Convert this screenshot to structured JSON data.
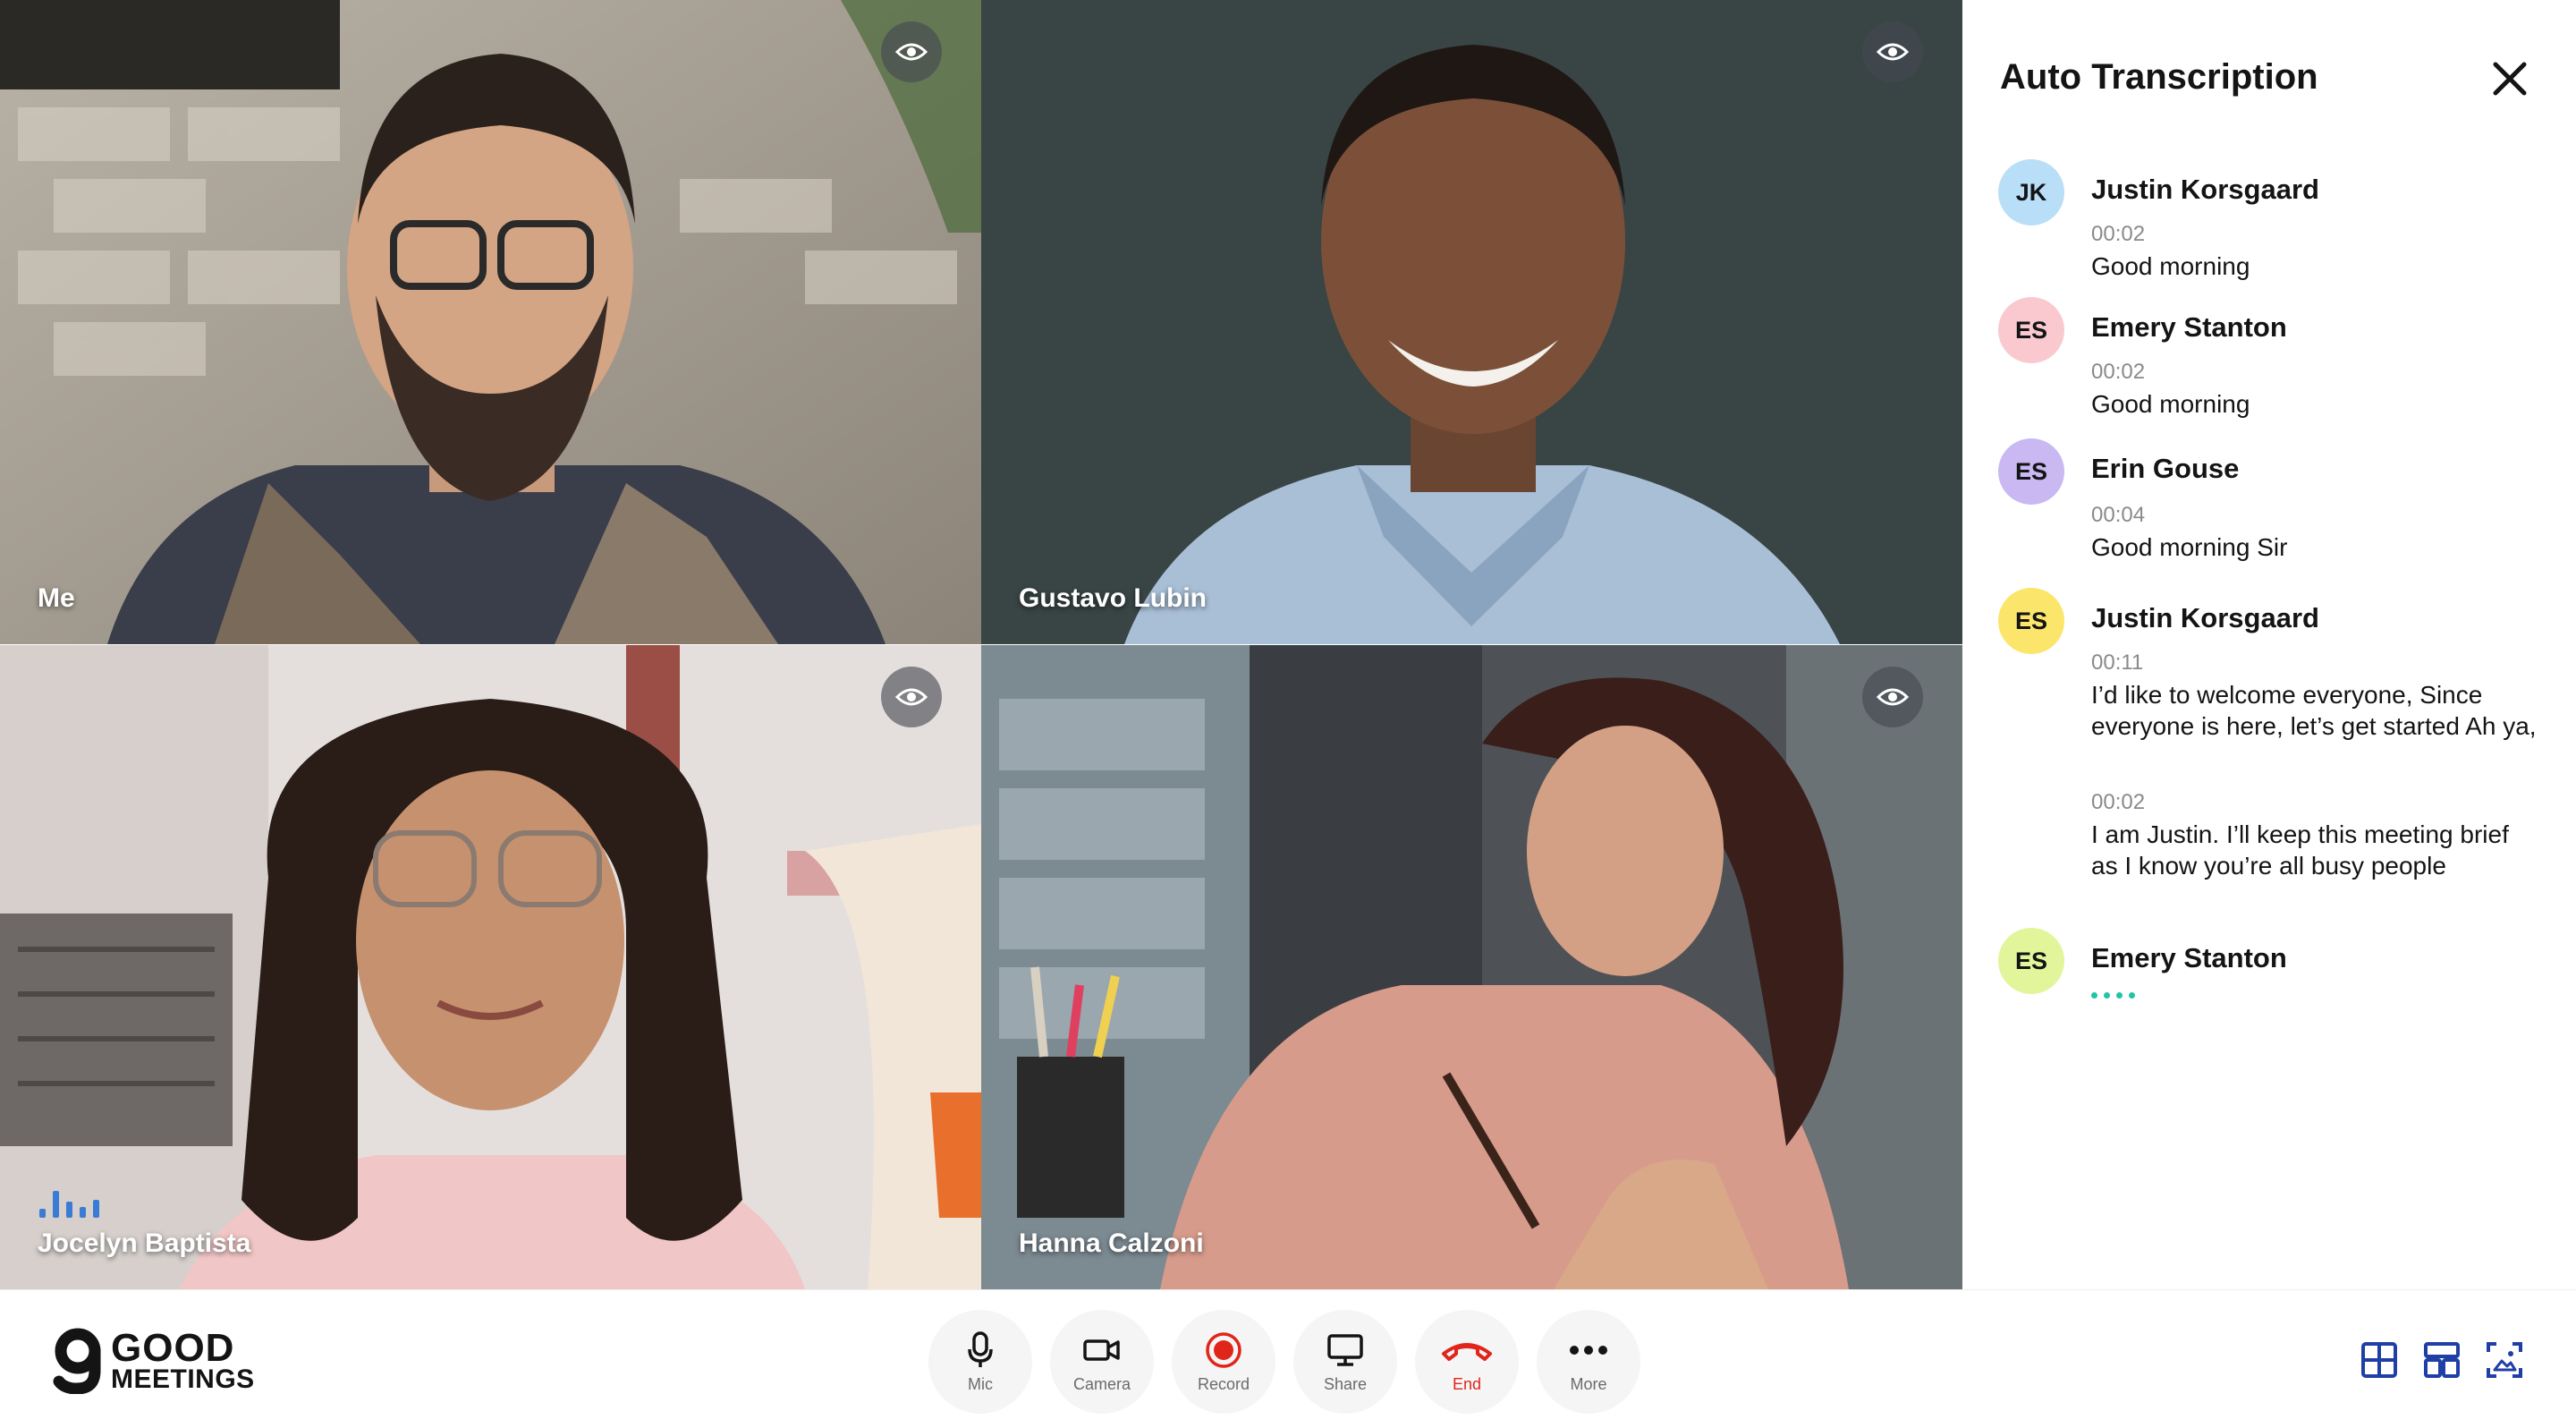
{
  "participants": [
    {
      "name": "Me"
    },
    {
      "name": "Gustavo Lubin"
    },
    {
      "name": "Jocelyn Baptista"
    },
    {
      "name": "Hanna Calzoni"
    }
  ],
  "transcription": {
    "title": "Auto Transcription",
    "entries": [
      {
        "initials": "JK",
        "avatar_color": "#b9def7",
        "name": "Justin Korsgaard",
        "segments": [
          {
            "time": "00:02",
            "text": "Good morning"
          }
        ]
      },
      {
        "initials": "ES",
        "avatar_color": "#f9c9cf",
        "name": "Emery Stanton",
        "segments": [
          {
            "time": "00:02",
            "text": "Good morning"
          }
        ]
      },
      {
        "initials": "ES",
        "avatar_color": "#c9b8f2",
        "name": "Erin Gouse",
        "segments": [
          {
            "time": "00:04",
            "text": "Good morning Sir"
          }
        ]
      },
      {
        "initials": "ES",
        "avatar_color": "#fbe56a",
        "name": "Justin Korsgaard",
        "segments": [
          {
            "time": "00:11",
            "text": "I’d like to welcome everyone, Since everyone is here, let’s get started Ah ya,"
          },
          {
            "time": "00:02",
            "text": "I am Justin. I’ll keep this meeting brief as I know you’re all busy people"
          }
        ]
      },
      {
        "initials": "ES",
        "avatar_color": "#e2f59a",
        "name": "Emery Stanton",
        "typing": true
      }
    ]
  },
  "toolbar": {
    "logo_line1": "GOOD",
    "logo_line2": "MEETINGS",
    "controls": [
      {
        "label": "Mic",
        "icon": "mic-icon"
      },
      {
        "label": "Camera",
        "icon": "camera-icon"
      },
      {
        "label": "Record",
        "icon": "record-icon"
      },
      {
        "label": "Share",
        "icon": "screen-share-icon"
      },
      {
        "label": "End",
        "icon": "phone-hangup-icon"
      },
      {
        "label": "More",
        "icon": "more-dots-icon"
      }
    ],
    "view_icons": [
      "grid-view-icon",
      "layout-view-icon",
      "fullscreen-view-icon"
    ]
  },
  "colors": {
    "accent_blue": "#1f3fa6",
    "end_red": "#e0251b",
    "typing_teal": "#22c3a6",
    "speaking_blue": "#3a7bd5"
  }
}
